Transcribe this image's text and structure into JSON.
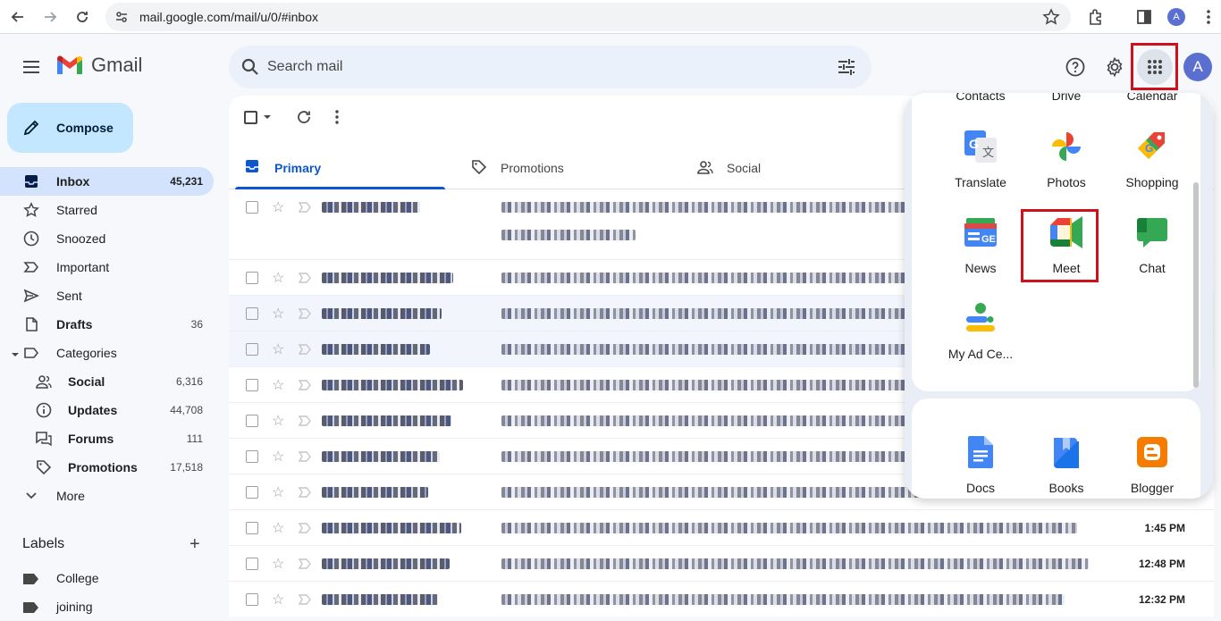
{
  "browser": {
    "url": "mail.google.com/mail/u/0/#inbox",
    "profile_initial": "A"
  },
  "header": {
    "app_name": "Gmail",
    "search_placeholder": "Search mail",
    "avatar_initial": "A"
  },
  "compose_label": "Compose",
  "nav": {
    "inbox": {
      "label": "Inbox",
      "count": "45,231"
    },
    "starred": {
      "label": "Starred"
    },
    "snoozed": {
      "label": "Snoozed"
    },
    "important": {
      "label": "Important"
    },
    "sent": {
      "label": "Sent"
    },
    "drafts": {
      "label": "Drafts",
      "count": "36"
    },
    "categories": {
      "label": "Categories"
    },
    "social": {
      "label": "Social",
      "count": "6,316"
    },
    "updates": {
      "label": "Updates",
      "count": "44,708"
    },
    "forums": {
      "label": "Forums",
      "count": "111"
    },
    "promotions": {
      "label": "Promotions",
      "count": "17,518"
    },
    "more": {
      "label": "More"
    }
  },
  "labels": {
    "heading": "Labels",
    "items": [
      "College",
      "joining"
    ]
  },
  "tabs": {
    "primary": "Primary",
    "promotions": "Promotions",
    "social": "Social"
  },
  "emails": [
    {
      "time": ""
    },
    {
      "time": ""
    },
    {
      "time": ""
    },
    {
      "time": ""
    },
    {
      "time": ""
    },
    {
      "time": ""
    },
    {
      "time": ""
    },
    {
      "time": ""
    },
    {
      "time": "1:45 PM"
    },
    {
      "time": "12:48 PM"
    },
    {
      "time": "12:32 PM"
    }
  ],
  "apps_panel": {
    "peek": [
      "Contacts",
      "Drive",
      "Calendar"
    ],
    "apps": [
      "Translate",
      "Photos",
      "Shopping",
      "News",
      "Meet",
      "Chat",
      "My Ad Ce..."
    ],
    "bottom_apps": [
      "Docs",
      "Books",
      "Blogger"
    ],
    "highlighted": "Meet"
  },
  "colors": {
    "accent": "#0b57d0",
    "highlight": "#d0101b",
    "compose_bg": "#c2e7ff",
    "inbox_active_bg": "#d3e3fd"
  }
}
